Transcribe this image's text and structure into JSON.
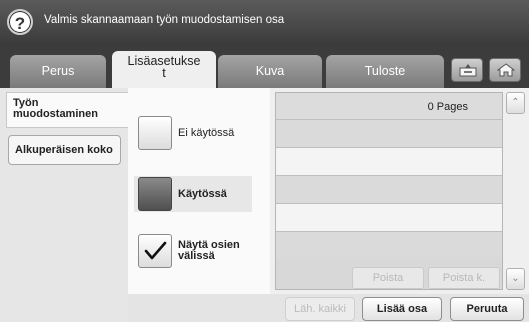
{
  "header": {
    "help_icon": "?",
    "title": "Valmis skannaamaan työn muodostamisen osa"
  },
  "tabs": [
    {
      "label": "Perus",
      "active": false
    },
    {
      "label": "Lisäasetukset",
      "active": true
    },
    {
      "label": "Kuva",
      "active": false
    },
    {
      "label": "Tuloste",
      "active": false
    }
  ],
  "tab_active_lines": [
    "Lisäasetukse",
    "t"
  ],
  "tab_icons": [
    "job-status-icon",
    "home-icon"
  ],
  "left_menu": {
    "active_lines": [
      "Työn",
      "muodostaminen"
    ],
    "item": "Alkuperäisen koko"
  },
  "options": {
    "off": "Ei käytössä",
    "on": "Käytössä",
    "show_lines": [
      "Näytä osien",
      "välissä"
    ]
  },
  "list": {
    "pages": "0 Pages"
  },
  "list_buttons": {
    "delete": "Poista",
    "delete_all": "Poista k."
  },
  "bottom_buttons": {
    "clear_all": "Läh. kaikki",
    "add": "Lisää osa",
    "cancel": "Peruuta"
  }
}
